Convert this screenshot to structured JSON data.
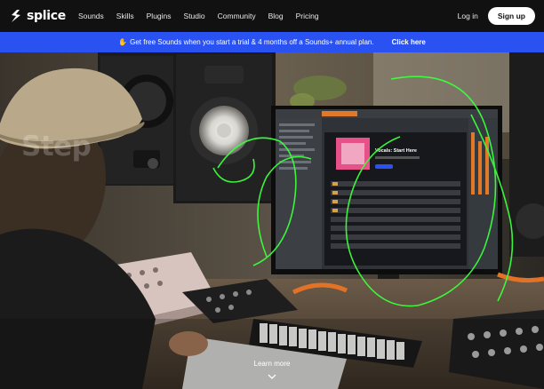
{
  "brand": {
    "name": "splice"
  },
  "nav": {
    "links": [
      "Sounds",
      "Skills",
      "Plugins",
      "Studio",
      "Community",
      "Blog",
      "Pricing"
    ],
    "login_label": "Log in",
    "signup_label": "Sign up"
  },
  "banner": {
    "message": "Get free Sounds when you start a trial & 4 months off a Sounds+ annual plan.",
    "cta": "Click here",
    "icon": "hand-wave-icon"
  },
  "hero": {
    "title": "Step",
    "learn_more": "Learn more",
    "screen": {
      "pack_title": "Vocals: Start Here"
    }
  },
  "colors": {
    "nav_bg": "#111111",
    "banner_bg": "#2a52f2",
    "accent_green": "#3cff3c"
  }
}
